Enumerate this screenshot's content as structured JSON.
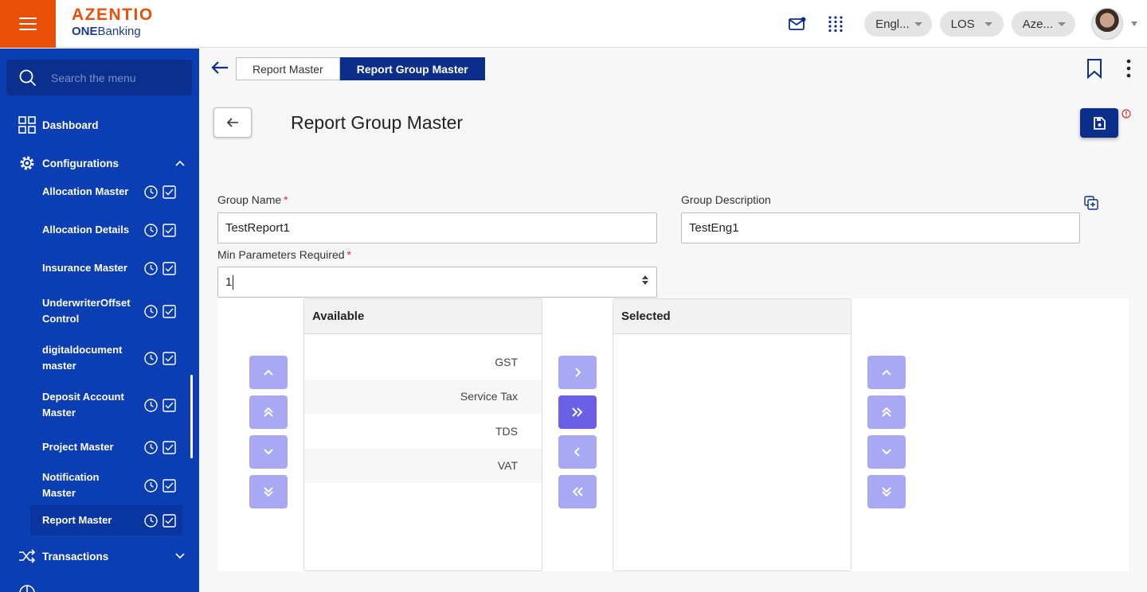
{
  "header": {
    "brand": "AZENTIO",
    "sub_brand_bold": "ONE",
    "sub_brand": "Banking",
    "language": "Engl...",
    "module": "LOS",
    "entity": "Aze..."
  },
  "sidebar": {
    "search_placeholder": "Search the menu",
    "dashboard": "Dashboard",
    "configurations": "Configurations",
    "transactions": "Transactions",
    "items": [
      {
        "label": "Allocation Master"
      },
      {
        "label": "Allocation Details"
      },
      {
        "label": "Insurance Master"
      },
      {
        "label": "UnderwriterOffsetControl"
      },
      {
        "label": "digitaldocumentmaster"
      },
      {
        "label": "Deposit Account Master"
      },
      {
        "label": "Project Master"
      },
      {
        "label": "Notification Master"
      },
      {
        "label": "Report Master"
      }
    ],
    "colors": {
      "bg": "#0b3db3",
      "search_bg": "#09308f"
    }
  },
  "tabs": [
    {
      "label": "Report Master",
      "active": false
    },
    {
      "label": "Report Group Master",
      "active": true
    }
  ],
  "page": {
    "title": "Report Group Master"
  },
  "form": {
    "group_name_label": "Group Name",
    "group_name_value": "TestReport1",
    "group_desc_label": "Group Description",
    "group_desc_value": "TestEng1",
    "min_params_label": "Min Parameters Required",
    "min_params_value": "1",
    "required_mark": "*"
  },
  "dual_list": {
    "available_header": "Available",
    "selected_header": "Selected",
    "available_items": [
      "GST",
      "Service Tax",
      "TDS",
      "VAT"
    ],
    "selected_items": []
  },
  "colors": {
    "accent": "#e8500a",
    "primary": "#0a2e8a",
    "button_light": "#a8a8f5",
    "button_active": "#6b5fe8"
  }
}
